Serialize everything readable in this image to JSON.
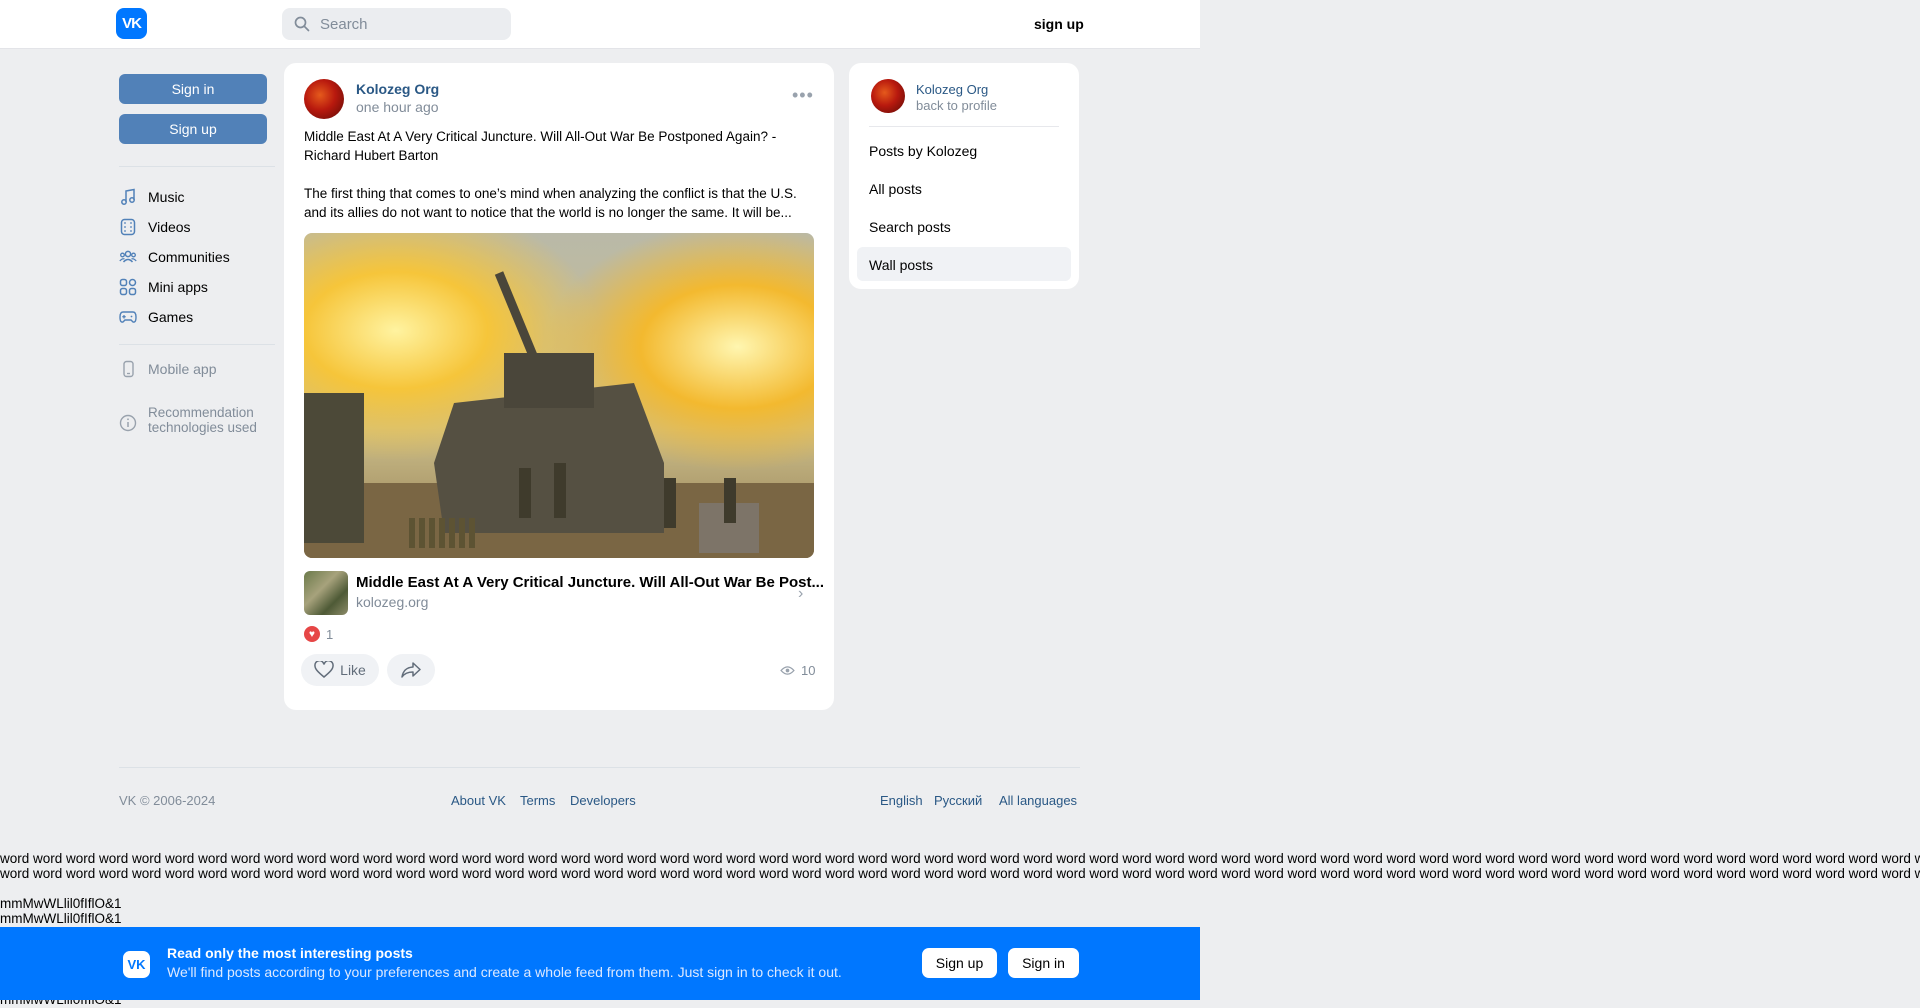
{
  "topbar": {
    "logo": "VK",
    "search_placeholder": "Search",
    "signup_label": "sign up"
  },
  "left": {
    "signin_label": "Sign in",
    "signup_label": "Sign up",
    "nav": [
      {
        "label": "Music",
        "icon": "music-icon"
      },
      {
        "label": "Videos",
        "icon": "video-icon"
      },
      {
        "label": "Communities",
        "icon": "communities-icon"
      },
      {
        "label": "Mini apps",
        "icon": "mini-apps-icon"
      },
      {
        "label": "Games",
        "icon": "games-icon"
      }
    ],
    "mobile_app": "Mobile app",
    "recommendation_line1": "Recommendation",
    "recommendation_line2": "technologies used"
  },
  "post": {
    "author": "Kolozeg Org",
    "time": "one hour ago",
    "title": "Middle East At A Very Critical Juncture. Will All-Out War Be Postponed Again? - Richard Hubert Barton",
    "body": "The first thing that comes to one’s mind when analyzing the conflict is that the U.S. and its allies do not want to notice that the world is no longer the same. It will be...",
    "link_title": "Middle East At A Very Critical Juncture. Will All-Out War Be Post...",
    "link_domain": "kolozeg.org",
    "reactions_count": "1",
    "like_label": "Like",
    "views": "10"
  },
  "sidebar_card": {
    "author": "Kolozeg Org",
    "back": "back to profile",
    "items": [
      "Posts by Kolozeg",
      "All posts",
      "Search posts",
      "Wall posts"
    ]
  },
  "footer": {
    "copyright": "VK © 2006-2024",
    "about": "About VK",
    "terms": "Terms",
    "developers": "Developers",
    "english": "English",
    "russian": "Русский",
    "all_languages": "All languages"
  },
  "stray": {
    "words_line": "word word word word word word word word word word word word word word word word word word word word word word word word word word word word word word word word word word word word word word word word word word word word word word word word word word word word word word word word word word word word wo",
    "glyph_line": "mmMwWLlil0fIflO&1"
  },
  "banner": {
    "logo": "VK",
    "title": "Read only the most interesting posts",
    "subtitle": "We'll find posts according to your preferences and create a whole feed from them. Just sign in to check it out.",
    "signup_label": "Sign up",
    "signin_label": "Sign in"
  },
  "colors": {
    "brand": "#0077ff",
    "button": "#5181b8",
    "link": "#2a5885",
    "background": "#edeef0"
  }
}
